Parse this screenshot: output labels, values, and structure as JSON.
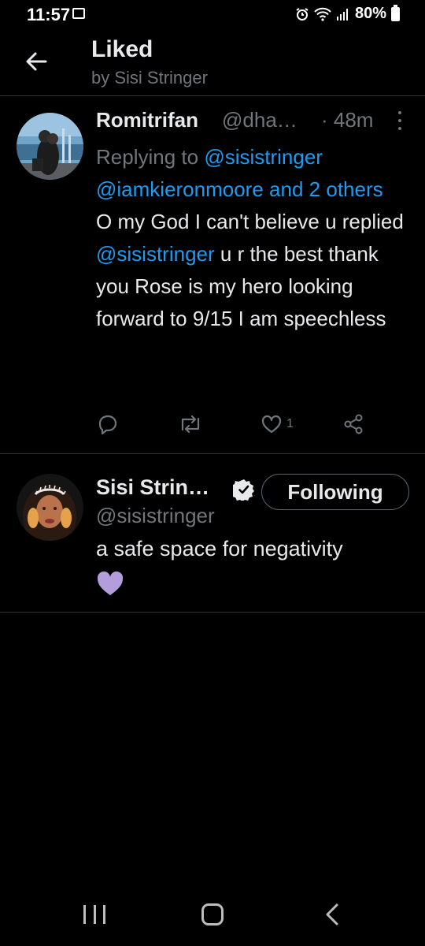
{
  "status_bar": {
    "time": "11:57",
    "battery": "80%"
  },
  "header": {
    "title": "Liked",
    "subtitle": "by Sisi Stringer"
  },
  "tweet": {
    "name": "Romitrifan",
    "handle": "@dha…",
    "time": "· 48m",
    "replying_prefix": "Replying to",
    "replying_mention_1": "@sisistringer",
    "replying_mention_2": "@iamkieronmoore",
    "replying_and": "and",
    "replying_others": "2 others",
    "text_1": "O my God I can't believe u replied",
    "text_mention": "@sisistringer",
    "text_2": "u r the best thank you Rose is my hero looking forward to 9/15 I am speechless",
    "like_count": "1"
  },
  "user_card": {
    "name": "Sisi Strin…",
    "handle": "@sisistringer",
    "follow_label": "Following",
    "bio": "a safe space for negativity"
  },
  "colors": {
    "accent": "#1d9bf0",
    "muted": "#71767b",
    "heart_emoji": "#b39ddb"
  },
  "icons": [
    "back-arrow-icon",
    "more-icon",
    "reply-icon",
    "retweet-icon",
    "like-icon",
    "share-icon",
    "verified-icon",
    "purple-heart-icon"
  ]
}
